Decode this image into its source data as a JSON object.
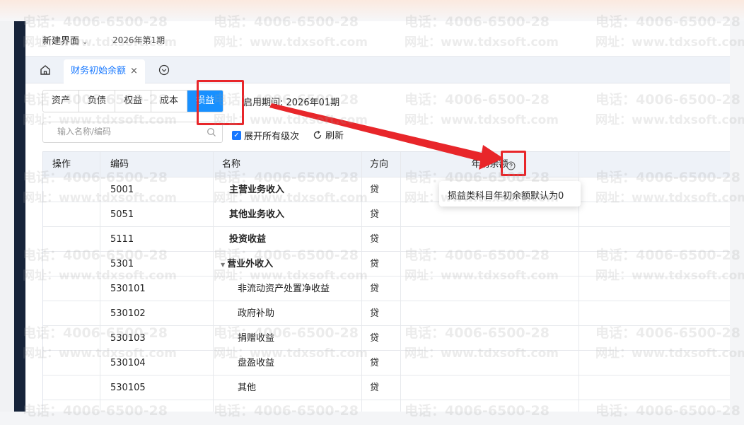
{
  "header": {
    "workspace_label": "新建界面",
    "period_label": "2026年第1期"
  },
  "tabs": {
    "active_label": "财务初始余额",
    "close_glyph": "×"
  },
  "category_tabs": [
    "资产",
    "负债",
    "权益",
    "成本",
    "损益"
  ],
  "active_category": "损益",
  "enable_period_label": "启用期间: 2026年01期",
  "search": {
    "placeholder": "输入名称/编码"
  },
  "toolbar": {
    "expand_all_label": "展开所有级次",
    "refresh_label": "刷新"
  },
  "table": {
    "headers": {
      "op": "操作",
      "code": "编码",
      "name": "名称",
      "direction": "方向",
      "balance": "年初余额"
    },
    "rows": [
      {
        "code": "5001",
        "name": "主营业务收入",
        "direction": "贷",
        "level": 1
      },
      {
        "code": "5051",
        "name": "其他业务收入",
        "direction": "贷",
        "level": 1
      },
      {
        "code": "5111",
        "name": "投资收益",
        "direction": "贷",
        "level": 1
      },
      {
        "code": "5301",
        "name": "营业外收入",
        "direction": "贷",
        "level": 1,
        "expanded": true
      },
      {
        "code": "530101",
        "name": "非流动资产处置净收益",
        "direction": "贷",
        "level": 2
      },
      {
        "code": "530102",
        "name": "政府补助",
        "direction": "贷",
        "level": 2
      },
      {
        "code": "530103",
        "name": "捐赠收益",
        "direction": "贷",
        "level": 2
      },
      {
        "code": "530104",
        "name": "盘盈收益",
        "direction": "贷",
        "level": 2
      },
      {
        "code": "530105",
        "name": "其他",
        "direction": "贷",
        "level": 2
      }
    ]
  },
  "tooltip": {
    "text": "损益类科目年初余额默认为0"
  },
  "watermark": {
    "line1": "电话：4006-6500-28",
    "line2": "网址：www.tdxsoft.com"
  },
  "colors": {
    "primary": "#1890ff",
    "annotation_red": "#e8262a"
  },
  "icons": [
    "home-icon",
    "chevron-down-icon",
    "close-icon",
    "more-circle-icon",
    "search-icon",
    "checkbox-checked-icon",
    "refresh-icon",
    "question-circle-icon",
    "caret-down-icon"
  ]
}
